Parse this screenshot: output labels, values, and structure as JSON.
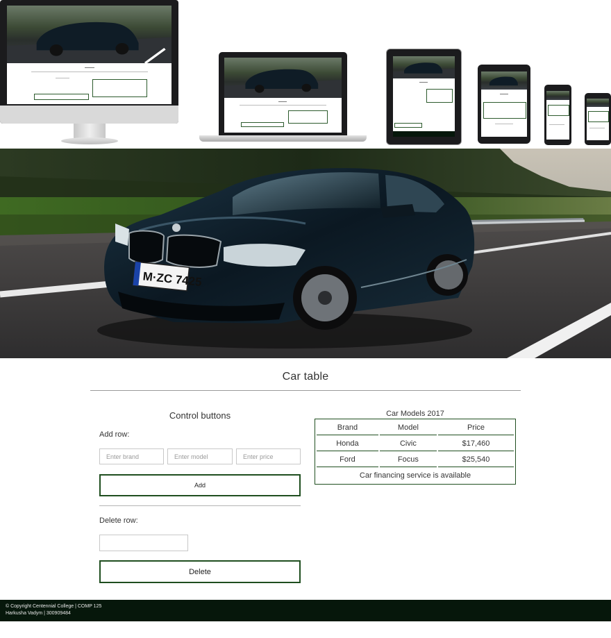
{
  "hero": {
    "plate": "M·ZC 7425"
  },
  "main": {
    "title": "Car table",
    "controls": {
      "heading": "Control buttons",
      "add_label": "Add row:",
      "brand_placeholder": "Enter brand",
      "model_placeholder": "Enter model",
      "price_placeholder": "Enter price",
      "add_button": "Add",
      "delete_label": "Delete row:",
      "delete_value": "",
      "delete_button": "Delete"
    },
    "table": {
      "caption": "Car Models 2017",
      "headers": [
        "Brand",
        "Model",
        "Price"
      ],
      "rows": [
        [
          "Honda",
          "Civic",
          "$17,460"
        ],
        [
          "Ford",
          "Focus",
          "$25,540"
        ]
      ],
      "note": "Car financing service is available"
    }
  },
  "footer": {
    "line1": "© Copyright Centennial College | COMP 125",
    "line2": "Harkusha Vadym | 300909484"
  },
  "colors": {
    "accent": "#1f4e1f",
    "footer_bg": "#06170b"
  }
}
